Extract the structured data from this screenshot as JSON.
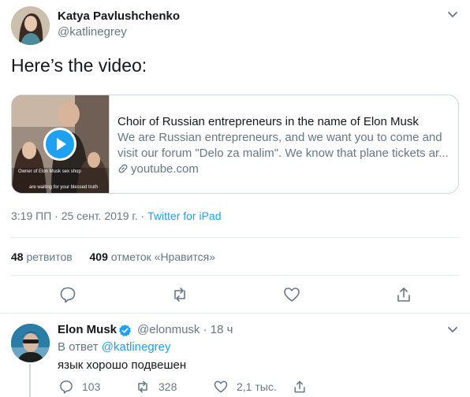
{
  "tweet": {
    "author_name": "Katya Pavlushchenko",
    "author_handle": "@katlinegrey",
    "text": "Here’s the video:",
    "card": {
      "title": "Choir of Russian entrepreneurs in the name of Elon Musk",
      "description_line1": "We are Russian entrepreneurs, and we want you to come and",
      "description_line2": "visit our forum \"Delo za malim\". We know that plane tickets ar...",
      "domain": "youtube.com",
      "thumb_caption1": "Owner of Elon Musk sex shop",
      "thumb_caption2": "are waiting for your blessed truth"
    },
    "time": "3:19 ПП",
    "separator": " · ",
    "date": "25 сент. 2019 г.",
    "client": "Twitter for iPad",
    "retweets_count": "48",
    "retweets_label": "ретвитов",
    "likes_count": "409",
    "likes_label": "отметок «Нравится»"
  },
  "reply": {
    "author_name": "Elon Musk",
    "author_handle": "@elonmusk",
    "time": "18 ч",
    "reply_prefix": "В ответ",
    "reply_to": "@katlinegrey",
    "text": "язык хорошо подвешен",
    "replies": "103",
    "retweets": "328",
    "likes": "2,1 тыс."
  },
  "icons": {
    "caret": "chevron-down-icon",
    "reply": "reply-icon",
    "retweet": "retweet-icon",
    "like": "heart-icon",
    "share": "share-icon",
    "link": "link-icon",
    "verified": "verified-badge-icon",
    "play": "play-icon"
  },
  "colors": {
    "accent": "#1da1f2",
    "secondary_text": "#657786",
    "primary_text": "#14171a",
    "border": "#e6ecf0"
  }
}
